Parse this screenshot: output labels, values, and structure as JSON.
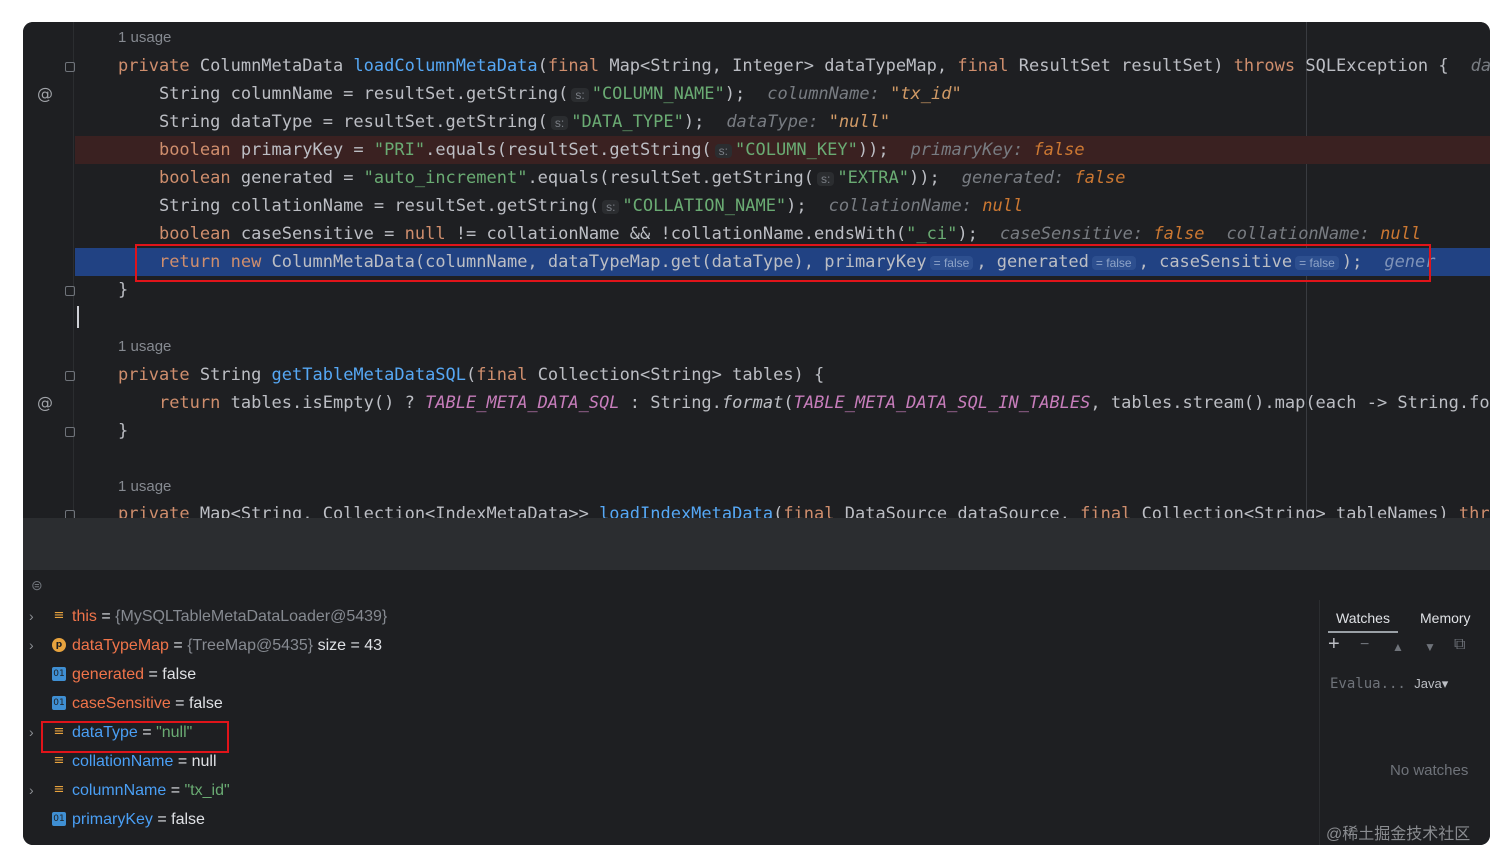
{
  "editor": {
    "usage1": "1 usage",
    "usage2": "1 usage",
    "usage3": "1 usage",
    "line1": {
      "p1": "private",
      "p2": " ColumnMetaData ",
      "p3": "loadColumnMetaData",
      "p4": "(",
      "p5": "final",
      "p6": " Map<String, Integer> dataTypeMap, ",
      "p7": "final",
      "p8": " ResultSet resultSet) ",
      "p9": "throws",
      "p10": " SQLException {",
      "hint": "data"
    },
    "line2": {
      "p1": "String columnName = resultSet.getString(",
      "h": "s:",
      "s": "\"COLUMN_NAME\"",
      "p2": ");",
      "n": "columnName:",
      "v": "\"tx_id\""
    },
    "line3": {
      "p1": "String dataType = resultSet.getString(",
      "h": "s:",
      "s": "\"DATA_TYPE\"",
      "p2": ");",
      "n": "dataType:",
      "v": "\"null\""
    },
    "line4": {
      "k": "boolean",
      "p1": " primaryKey = ",
      "s1": "\"PRI\"",
      "p2": ".equals(resultSet.getString(",
      "h": "s:",
      "s2": "\"COLUMN_KEY\"",
      "p3": "));",
      "n": "primaryKey:",
      "v": "false"
    },
    "line5": {
      "k": "boolean",
      "p1": " generated = ",
      "s1": "\"auto_increment\"",
      "p2": ".equals(resultSet.getString(",
      "h": "s:",
      "s2": "\"EXTRA\"",
      "p3": "));",
      "n": "generated:",
      "v": "false"
    },
    "line6": {
      "p1": "String collationName = resultSet.getString(",
      "h": "s:",
      "s": "\"COLLATION_NAME\"",
      "p2": ");",
      "n": "collationName:",
      "v": "null"
    },
    "line7": {
      "k": "boolean",
      "p1": " caseSensitive = ",
      "k2": "null",
      "p2": " != collationName && !collationName.endsWith(",
      "s": "\"_ci\"",
      "p3": ");",
      "n1": "caseSensitive:",
      "v1": "false",
      "n2": "collationName:",
      "v2": "null"
    },
    "line8": {
      "k1": "return",
      "k2": " new",
      "p1": " ColumnMetaData(columnName, dataTypeMap.get(dataType), primaryKey",
      "h1": "= false",
      "p2": ", generated",
      "h2": "= false",
      "p3": ", caseSensitive",
      "h3": "= false",
      "p4": ");",
      "tail": "gener"
    },
    "line9": "}",
    "line10": {
      "p1": "private",
      "p2": " String ",
      "p3": "getTableMetaDataSQL",
      "p4": "(",
      "p5": "final",
      "p6": " Collection<String> tables) {"
    },
    "line11": {
      "k": "return",
      "p1": " tables.isEmpty() ? ",
      "c1": "TABLE_META_DATA_SQL",
      "p2": " : String.",
      "f": "format",
      "p3": "(",
      "c2": "TABLE_META_DATA_SQL_IN_TABLES",
      "p4": ", tables.stream().map(each -> String.fo"
    },
    "line12": "}",
    "line13": {
      "p1": "private",
      "p2": " Map<String, Collection<IndexMetaData>> ",
      "p3": "loadIndexMetaData",
      "p4": "(",
      "p5": "final",
      "p6": " DataSource dataSource, ",
      "p7": "final",
      "p8": " Collection<String> tableNames) ",
      "p9": "throw"
    }
  },
  "variables": [
    {
      "name": "this",
      "eq": " = ",
      "value": "{MySQLTableMetaDataLoader@5439}",
      "kind": "obj",
      "extra": "",
      "icon": "lines",
      "expand": true,
      "changed": false
    },
    {
      "name": "dataTypeMap",
      "eq": " = ",
      "value": "{TreeMap@5435}",
      "kind": "obj",
      "extra": " size = 43",
      "icon": "p",
      "expand": true,
      "changed": false
    },
    {
      "name": "generated",
      "eq": " = ",
      "value": "false",
      "kind": "plain",
      "extra": "",
      "icon": "ol",
      "expand": false,
      "changed": false
    },
    {
      "name": "caseSensitive",
      "eq": " = ",
      "value": "false",
      "kind": "plain",
      "extra": "",
      "icon": "ol",
      "expand": false,
      "changed": false
    },
    {
      "name": "dataType",
      "eq": " = ",
      "value": "\"null\"",
      "kind": "str",
      "extra": "",
      "icon": "lines",
      "expand": true,
      "changed": true
    },
    {
      "name": "collationName",
      "eq": " = ",
      "value": "null",
      "kind": "plain",
      "extra": "",
      "icon": "lines",
      "expand": false,
      "changed": true
    },
    {
      "name": "columnName",
      "eq": " = ",
      "value": "\"tx_id\"",
      "kind": "str",
      "extra": "",
      "icon": "lines",
      "expand": true,
      "changed": true
    },
    {
      "name": "primaryKey",
      "eq": " = ",
      "value": "false",
      "kind": "plain",
      "extra": "",
      "icon": "ol",
      "expand": false,
      "changed": true
    }
  ],
  "icons": {
    "lines": "≡",
    "p": "p",
    "ol": "01",
    "arrow": "›",
    "layout": "⊜"
  },
  "watches": {
    "tab_watches": "Watches",
    "tab_memory": "Memory",
    "add": "+",
    "remove": "−",
    "up": "▲",
    "down": "▼",
    "copy": "⧉",
    "eval_placeholder": "Evalua...",
    "lang": "Java▾",
    "empty": "No watches"
  },
  "watermark": "@稀土掘金技术社区",
  "colors": {
    "error_line": "#3a2121",
    "exec_line": "#214283",
    "highlight_box": "#e0141a"
  }
}
